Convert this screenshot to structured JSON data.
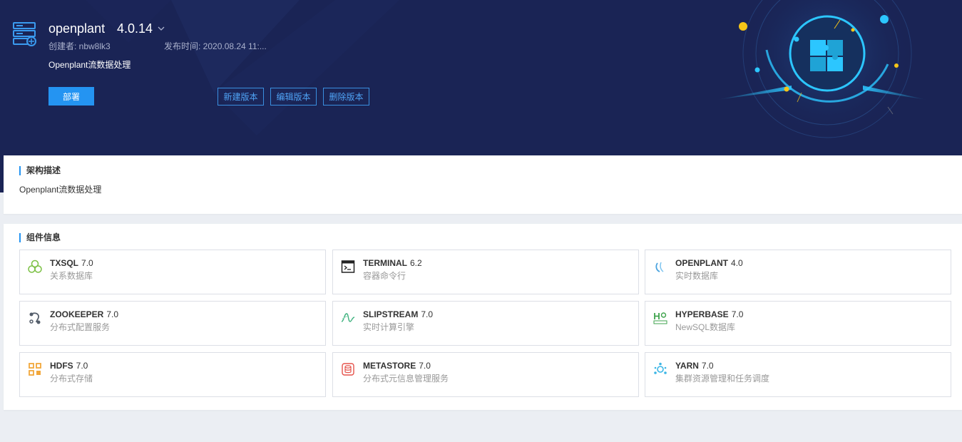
{
  "header": {
    "app_name": "openplant",
    "version": "4.0.14",
    "creator": "创建者: nbw8lk3",
    "publish_time": "发布时间: 2020.08.24 11:...",
    "description": "Openplant流数据处理",
    "deploy_label": "部署",
    "new_version_label": "新建版本",
    "edit_version_label": "编辑版本",
    "delete_version_label": "删除版本",
    "icons": {
      "app": "server-icon",
      "caret": "chevron-down-icon",
      "art": "puzzle-icon"
    }
  },
  "architecture": {
    "title": "架构描述",
    "text": "Openplant流数据处理"
  },
  "components": {
    "title": "组件信息",
    "items": [
      {
        "name": "TXSQL",
        "version": "7.0",
        "desc": "关系数据库",
        "icon": "txsql-icon",
        "color": "#7bc043"
      },
      {
        "name": "TERMINAL",
        "version": "6.2",
        "desc": "容器命令行",
        "icon": "terminal-icon",
        "color": "#222222"
      },
      {
        "name": "OPENPLANT",
        "version": "4.0",
        "desc": "实时数据库",
        "icon": "openplant-icon",
        "color": "#4aa3df"
      },
      {
        "name": "ZOOKEEPER",
        "version": "7.0",
        "desc": "分布式配置服务",
        "icon": "zookeeper-icon",
        "color": "#555e6b"
      },
      {
        "name": "SLIPSTREAM",
        "version": "7.0",
        "desc": "实时计算引擎",
        "icon": "slipstream-icon",
        "color": "#3fb27f"
      },
      {
        "name": "HYPERBASE",
        "version": "7.0",
        "desc": "NewSQL数据库",
        "icon": "hyperbase-icon",
        "color": "#3fa34d"
      },
      {
        "name": "HDFS",
        "version": "7.0",
        "desc": "分布式存储",
        "icon": "hdfs-icon",
        "color": "#f2a73b"
      },
      {
        "name": "METASTORE",
        "version": "7.0",
        "desc": "分布式元信息管理服务",
        "icon": "metastore-icon",
        "color": "#e5534b"
      },
      {
        "name": "YARN",
        "version": "7.0",
        "desc": "集群资源管理和任务调度",
        "icon": "yarn-icon",
        "color": "#3cb6e6"
      }
    ]
  },
  "colors": {
    "hero_bg": "#1a2455",
    "accent": "#2494f2",
    "page_bg": "#ebeef3"
  }
}
